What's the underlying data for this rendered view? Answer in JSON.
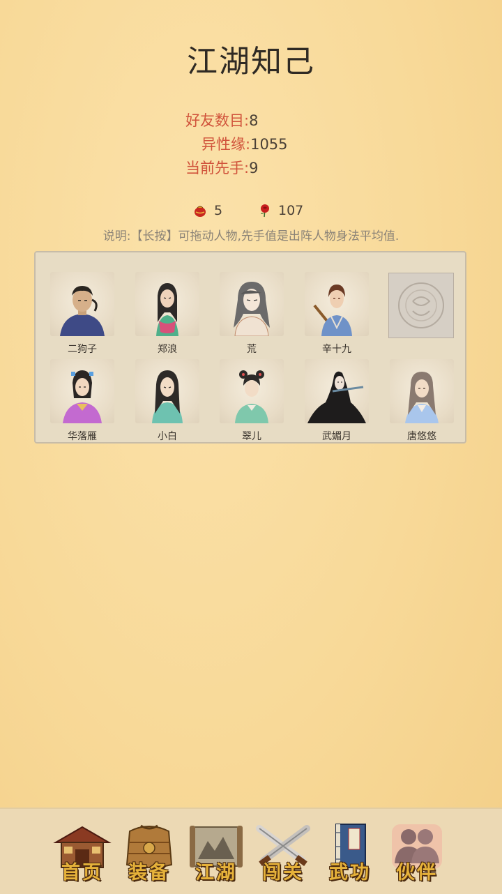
{
  "page": {
    "title": "江湖知己"
  },
  "stats": [
    {
      "key": "好友数目:",
      "value": "8"
    },
    {
      "key": "异性缘:",
      "value": "1055"
    },
    {
      "key": "当前先手:",
      "value": "9"
    }
  ],
  "resources": [
    {
      "icon": "red-pouch-icon",
      "value": "5"
    },
    {
      "icon": "red-rose-icon",
      "value": "107"
    }
  ],
  "note": "说明:【长按】可拖动人物,先手值是出阵人物身法平均值.",
  "companions": [
    {
      "name": "二狗子",
      "icon": "man-blue-robe-portrait"
    },
    {
      "name": "郑浪",
      "icon": "woman-green-robe-portrait"
    },
    {
      "name": "荒",
      "icon": "long-hair-portrait"
    },
    {
      "name": "辛十九",
      "icon": "swordsman-blue-portrait"
    },
    {
      "name": "",
      "icon": "empty-slot-seal-icon"
    },
    {
      "name": "华落雁",
      "icon": "woman-purple-robe-portrait"
    },
    {
      "name": "小白",
      "icon": "woman-teal-robe-portrait"
    },
    {
      "name": "翠儿",
      "icon": "girl-green-robe-portrait"
    },
    {
      "name": "武媚月",
      "icon": "woman-black-flute-portrait"
    },
    {
      "name": "唐悠悠",
      "icon": "woman-lightblue-portrait"
    }
  ],
  "nav": [
    {
      "label": "首页",
      "icon": "house-icon",
      "active": false
    },
    {
      "label": "装备",
      "icon": "armor-icon",
      "active": false
    },
    {
      "label": "江湖",
      "icon": "scroll-map-icon",
      "active": false
    },
    {
      "label": "闯关",
      "icon": "crossed-swords-icon",
      "active": false
    },
    {
      "label": "武功",
      "icon": "book-icon",
      "active": false
    },
    {
      "label": "伙伴",
      "icon": "companions-icon",
      "active": true
    }
  ],
  "colors": {
    "accent_red": "#d0533b",
    "nav_gold": "#e6b23a",
    "panel_bg": "#e7dcc4"
  }
}
